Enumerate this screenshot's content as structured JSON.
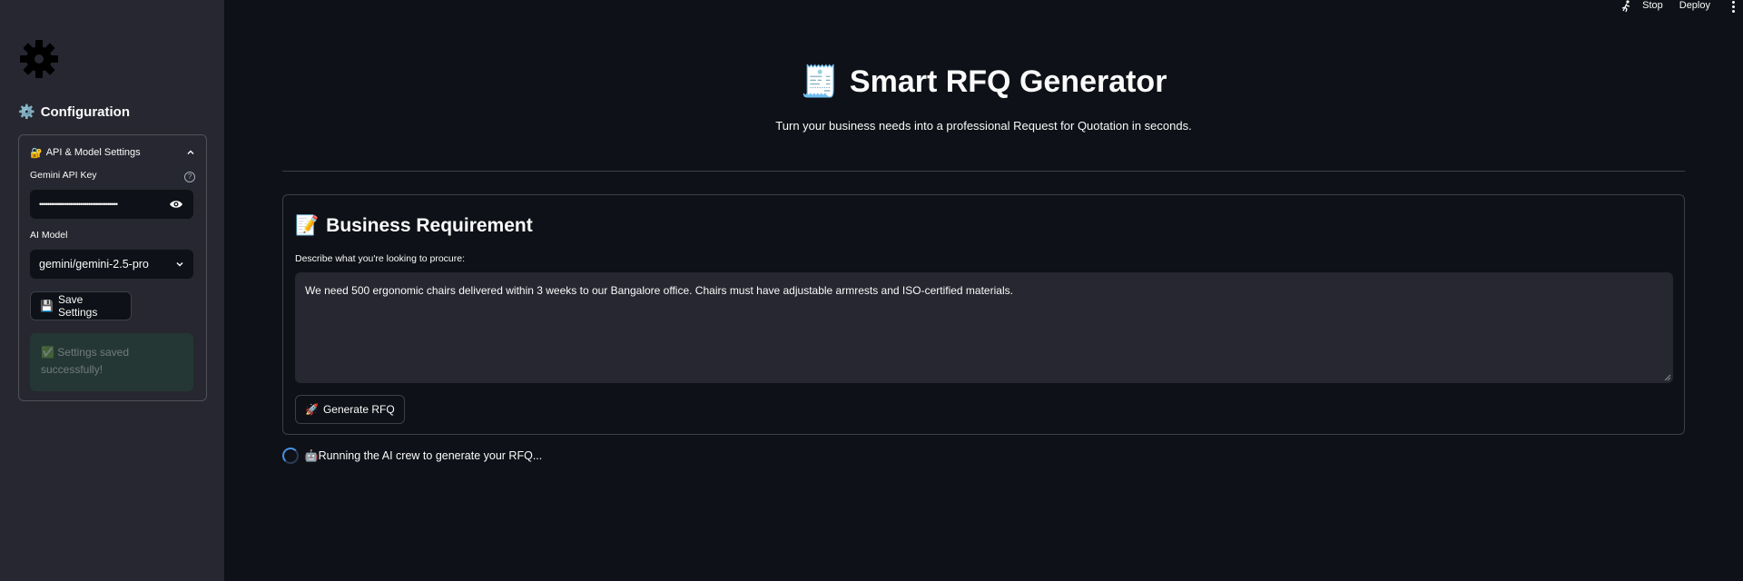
{
  "sidebar": {
    "config_title": "Configuration",
    "expander_title": "API & Model Settings",
    "api_key_label": "Gemini API Key",
    "api_key_value": "••••••••••••••••••••••••••••••••••••••••",
    "model_label": "AI Model",
    "model_value": "gemini/gemini-2.5-pro",
    "save_button": "Save Settings",
    "success_message": "Settings saved successfully!"
  },
  "topbar": {
    "stop": "Stop",
    "deploy": "Deploy"
  },
  "main": {
    "title": "Smart RFQ Generator",
    "subtitle": "Turn your business needs into a professional Request for Quotation in seconds.",
    "card_title": "Business Requirement",
    "textarea_label": "Describe what you're looking to procure:",
    "textarea_value": "We need 500 ergonomic chairs delivered within 3 weeks to our Bangalore office. Chairs must have adjustable armrests and ISO-certified materials.",
    "generate_button": "Generate RFQ",
    "status_text": "Running the AI crew to generate your RFQ..."
  },
  "colors": {
    "background": "#0e1117",
    "sidebar": "#262730",
    "text": "#fafafa",
    "spinner": "#4a90e2",
    "success_bg": "#1c2a22"
  },
  "icons": {
    "logo": "gear-icon",
    "config": "gear-icon",
    "expander": "lock-key-icon",
    "title": "receipt-icon",
    "card": "memo-icon",
    "save": "floppy-disk-icon",
    "success": "check-mark-icon",
    "generate": "rocket-icon",
    "status": "robot-icon"
  }
}
